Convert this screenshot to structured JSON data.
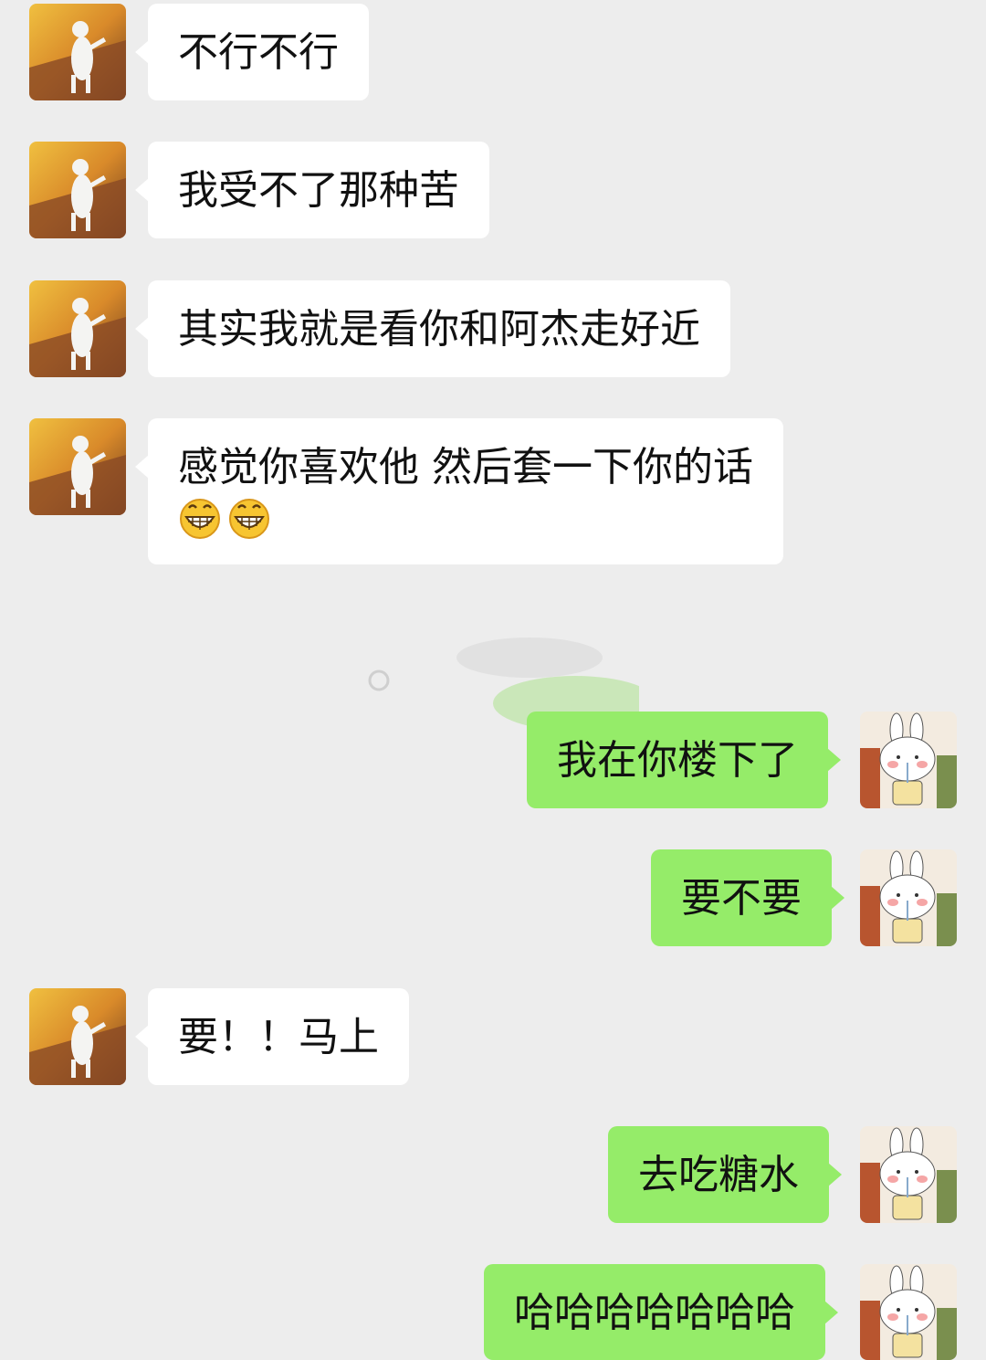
{
  "messages": [
    {
      "side": "in",
      "text": "不行不行",
      "avatar": "alpaca-dance-avatar"
    },
    {
      "side": "in",
      "text": "我受不了那种苦",
      "avatar": "alpaca-dance-avatar"
    },
    {
      "side": "in",
      "text": "其实我就是看你和阿杰走好近",
      "avatar": "alpaca-dance-avatar"
    },
    {
      "side": "in",
      "text": "感觉你喜欢他 然后套一下你的话",
      "emojis": [
        "grin-emoji",
        "grin-emoji"
      ],
      "avatar": "alpaca-dance-avatar"
    },
    {
      "side": "out",
      "text": "我在你楼下了",
      "avatar": "bunny-drink-avatar"
    },
    {
      "side": "out",
      "text": "要不要",
      "avatar": "bunny-drink-avatar"
    },
    {
      "side": "in",
      "text": "要！！马上",
      "avatar": "alpaca-dance-avatar"
    },
    {
      "side": "out",
      "text": "去吃糖水",
      "avatar": "bunny-drink-avatar"
    },
    {
      "side": "out",
      "text": "哈哈哈哈哈哈哈",
      "avatar": "bunny-drink-avatar"
    }
  ],
  "colors": {
    "background": "#ededed",
    "incoming_bubble": "#ffffff",
    "outgoing_bubble": "#95ec69"
  }
}
